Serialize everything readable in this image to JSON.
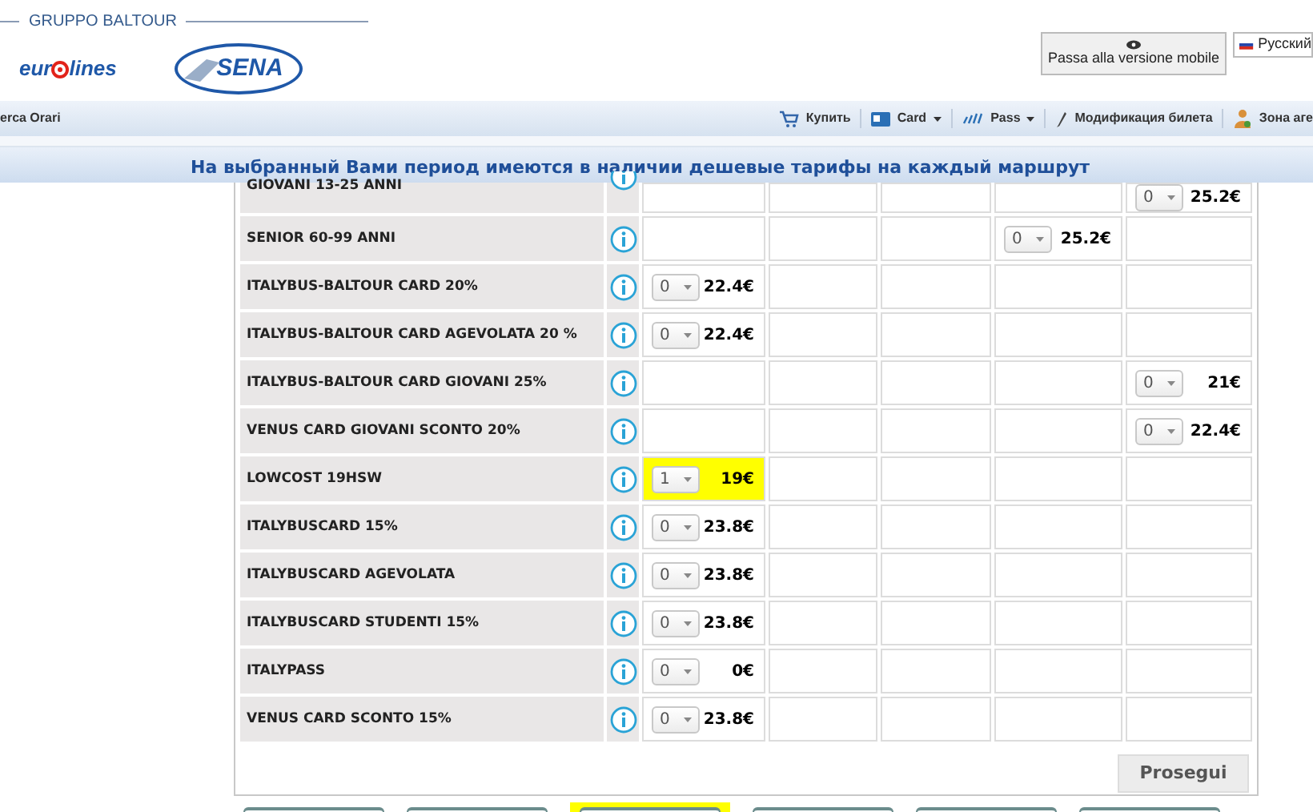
{
  "header": {
    "group": "GRUPPO BALTOUR",
    "logo_left": {
      "before": "eur",
      "after": "lines"
    },
    "logo_right": "SENA",
    "mobile_button": "Passa alla versione mobile",
    "language": "Русский"
  },
  "nav": {
    "left": "erca Orari",
    "items": [
      {
        "kind": "cart",
        "label": "Купить"
      },
      {
        "kind": "card",
        "label": "Card",
        "dropdown": true
      },
      {
        "kind": "pass",
        "label": "Pass",
        "dropdown": true
      },
      {
        "kind": "pencil",
        "label": "Модификация билета"
      },
      {
        "kind": "person",
        "label": "Зона аге"
      }
    ]
  },
  "banner": "На выбранный Вами период имеются в наличии дешевые тарифы на каждый маршрут",
  "fares": [
    {
      "name": "GIOVANI 13-25 ANNI",
      "cells": [
        {
          "kind": "empty"
        },
        {
          "kind": "empty"
        },
        {
          "kind": "empty"
        },
        {
          "kind": "empty"
        },
        {
          "kind": "fare",
          "quantity": "0",
          "price": "25.2€",
          "selected": false
        }
      ]
    },
    {
      "name": "SENIOR 60-99 ANNI",
      "cells": [
        {
          "kind": "empty"
        },
        {
          "kind": "empty"
        },
        {
          "kind": "empty"
        },
        {
          "kind": "fare",
          "quantity": "0",
          "price": "25.2€",
          "selected": false
        },
        {
          "kind": "empty"
        }
      ]
    },
    {
      "name": "ITALYBUS-BALTOUR CARD 20%",
      "cells": [
        {
          "kind": "fare",
          "quantity": "0",
          "price": "22.4€",
          "selected": false
        },
        {
          "kind": "empty"
        },
        {
          "kind": "empty"
        },
        {
          "kind": "empty"
        },
        {
          "kind": "empty"
        }
      ]
    },
    {
      "name": "ITALYBUS-BALTOUR CARD AGEVOLATA 20 %",
      "cells": [
        {
          "kind": "fare",
          "quantity": "0",
          "price": "22.4€",
          "selected": false
        },
        {
          "kind": "empty"
        },
        {
          "kind": "empty"
        },
        {
          "kind": "empty"
        },
        {
          "kind": "empty"
        }
      ]
    },
    {
      "name": "ITALYBUS-BALTOUR CARD GIOVANI 25%",
      "cells": [
        {
          "kind": "empty"
        },
        {
          "kind": "empty"
        },
        {
          "kind": "empty"
        },
        {
          "kind": "empty"
        },
        {
          "kind": "fare",
          "quantity": "0",
          "price": "21€",
          "selected": false
        }
      ]
    },
    {
      "name": "VENUS CARD GIOVANI SCONTO 20%",
      "cells": [
        {
          "kind": "empty"
        },
        {
          "kind": "empty"
        },
        {
          "kind": "empty"
        },
        {
          "kind": "empty"
        },
        {
          "kind": "fare",
          "quantity": "0",
          "price": "22.4€",
          "selected": false
        }
      ]
    },
    {
      "name": "LOWCOST 19HSW",
      "cells": [
        {
          "kind": "fare",
          "quantity": "1",
          "price": "19€",
          "selected": true
        },
        {
          "kind": "empty"
        },
        {
          "kind": "empty"
        },
        {
          "kind": "empty"
        },
        {
          "kind": "empty"
        }
      ]
    },
    {
      "name": "ITALYBUSCARD 15%",
      "cells": [
        {
          "kind": "fare",
          "quantity": "0",
          "price": "23.8€",
          "selected": false
        },
        {
          "kind": "empty"
        },
        {
          "kind": "empty"
        },
        {
          "kind": "empty"
        },
        {
          "kind": "empty"
        }
      ]
    },
    {
      "name": "ITALYBUSCARD AGEVOLATA",
      "cells": [
        {
          "kind": "fare",
          "quantity": "0",
          "price": "23.8€",
          "selected": false
        },
        {
          "kind": "empty"
        },
        {
          "kind": "empty"
        },
        {
          "kind": "empty"
        },
        {
          "kind": "empty"
        }
      ]
    },
    {
      "name": "ITALYBUSCARD STUDENTI 15%",
      "cells": [
        {
          "kind": "fare",
          "quantity": "0",
          "price": "23.8€",
          "selected": false
        },
        {
          "kind": "empty"
        },
        {
          "kind": "empty"
        },
        {
          "kind": "empty"
        },
        {
          "kind": "empty"
        }
      ]
    },
    {
      "name": "ITALYPASS",
      "cells": [
        {
          "kind": "fare",
          "quantity": "0",
          "price": "0€",
          "selected": false
        },
        {
          "kind": "empty"
        },
        {
          "kind": "empty"
        },
        {
          "kind": "empty"
        },
        {
          "kind": "empty"
        }
      ]
    },
    {
      "name": "VENUS CARD SCONTO 15%",
      "cells": [
        {
          "kind": "fare",
          "quantity": "0",
          "price": "23.8€",
          "selected": false
        },
        {
          "kind": "empty"
        },
        {
          "kind": "empty"
        },
        {
          "kind": "empty"
        },
        {
          "kind": "empty"
        }
      ]
    }
  ],
  "continue_button": "Prosegui",
  "bottom_buttons": [
    {
      "selected": false
    },
    {
      "selected": false
    },
    {
      "selected": true
    },
    {
      "selected": false
    },
    {
      "selected": false
    },
    {
      "selected": false
    }
  ]
}
